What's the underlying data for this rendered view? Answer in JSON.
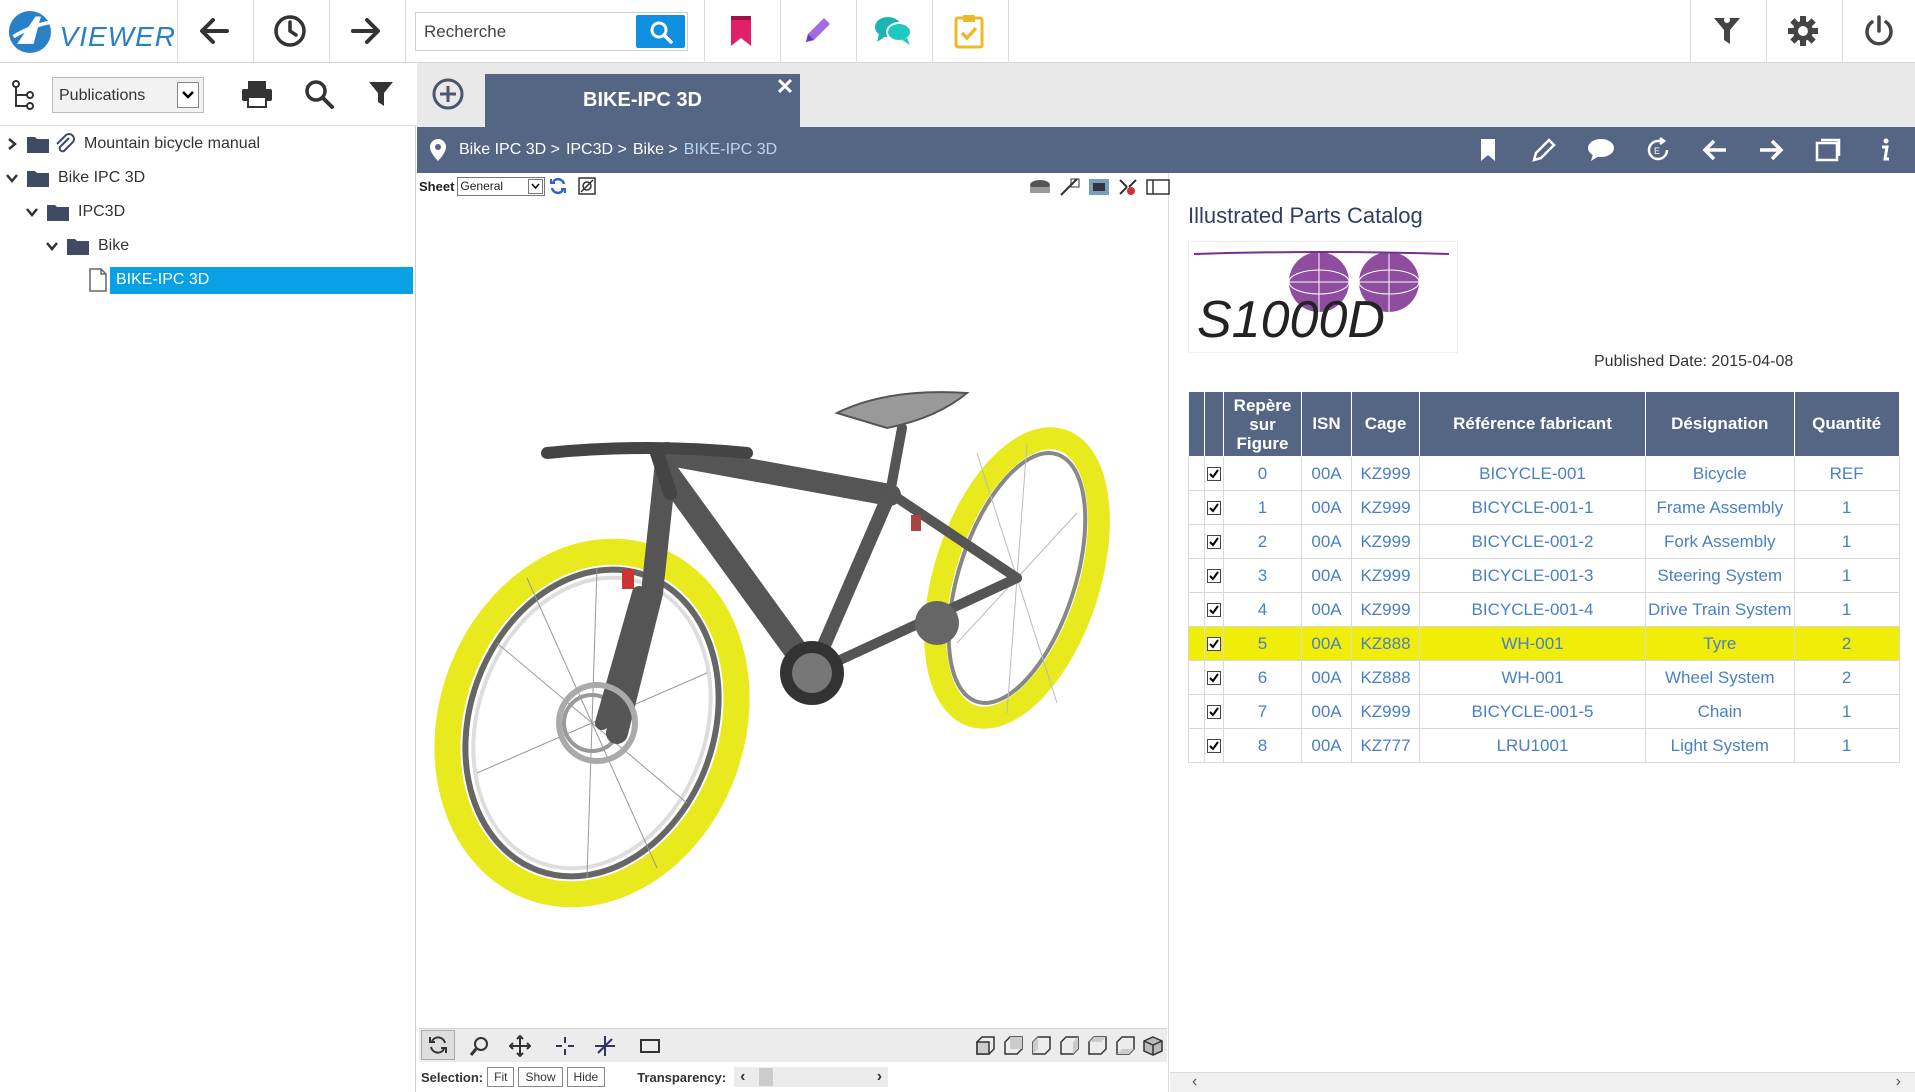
{
  "app": {
    "logo_text": "VIEWER",
    "search_placeholder": "Recherche",
    "search_value": "Recherche"
  },
  "colors": {
    "accent": "#0f8fdf",
    "header": "#556584",
    "bookmark": "#e0206a",
    "pencil": "#a36ae6",
    "comment": "#1ab5b3",
    "clipboard": "#f0b729",
    "highlight": "#f0ee08",
    "tyre": "#e8ea1e"
  },
  "left_panel": {
    "selector_value": "Publications",
    "tree": [
      {
        "label": "Mountain bicycle manual",
        "level": 0,
        "expanded": false
      },
      {
        "label": "Bike IPC 3D",
        "level": 0,
        "expanded": true
      },
      {
        "label": "IPC3D",
        "level": 1,
        "expanded": true
      },
      {
        "label": "Bike",
        "level": 2,
        "expanded": true
      },
      {
        "label": "BIKE-IPC 3D",
        "level": 3,
        "selected": true
      }
    ]
  },
  "tabs": {
    "active": "BIKE-IPC 3D"
  },
  "breadcrumb": [
    "Bike IPC 3D >",
    "IPC3D >",
    "Bike >",
    "BIKE-IPC 3D"
  ],
  "viewer": {
    "sheet_label": "Sheet",
    "sheet_value": "General",
    "selection_label": "Selection:",
    "fit_label": "Fit",
    "show_label": "Show",
    "hide_label": "Hide",
    "transparency_label": "Transparency:"
  },
  "ipc": {
    "title": "Illustrated Parts Catalog",
    "logo_text": "S1000D",
    "published": "Published Date: 2015-04-08",
    "columns": [
      "Repère sur Figure",
      "ISN",
      "Cage",
      "Référence fabricant",
      "Désignation",
      "Quantité"
    ],
    "rows": [
      {
        "fig": "0",
        "isn": "00A",
        "cage": "KZ999",
        "ref": "BICYCLE-001",
        "des": "Bicycle",
        "qty": "REF"
      },
      {
        "fig": "1",
        "isn": "00A",
        "cage": "KZ999",
        "ref": "BICYCLE-001-1",
        "des": "Frame Assembly",
        "qty": "1"
      },
      {
        "fig": "2",
        "isn": "00A",
        "cage": "KZ999",
        "ref": "BICYCLE-001-2",
        "des": "Fork Assembly",
        "qty": "1"
      },
      {
        "fig": "3",
        "isn": "00A",
        "cage": "KZ999",
        "ref": "BICYCLE-001-3",
        "des": "Steering System",
        "qty": "1"
      },
      {
        "fig": "4",
        "isn": "00A",
        "cage": "KZ999",
        "ref": "BICYCLE-001-4",
        "des": "Drive Train System",
        "qty": "1"
      },
      {
        "fig": "5",
        "isn": "00A",
        "cage": "KZ888",
        "ref": "WH-001",
        "des": "Tyre",
        "qty": "2",
        "highlight": true
      },
      {
        "fig": "6",
        "isn": "00A",
        "cage": "KZ888",
        "ref": "WH-001",
        "des": "Wheel System",
        "qty": "2"
      },
      {
        "fig": "7",
        "isn": "00A",
        "cage": "KZ999",
        "ref": "BICYCLE-001-5",
        "des": "Chain",
        "qty": "1"
      },
      {
        "fig": "8",
        "isn": "00A",
        "cage": "KZ777",
        "ref": "LRU1001",
        "des": "Light System",
        "qty": "1"
      }
    ]
  }
}
